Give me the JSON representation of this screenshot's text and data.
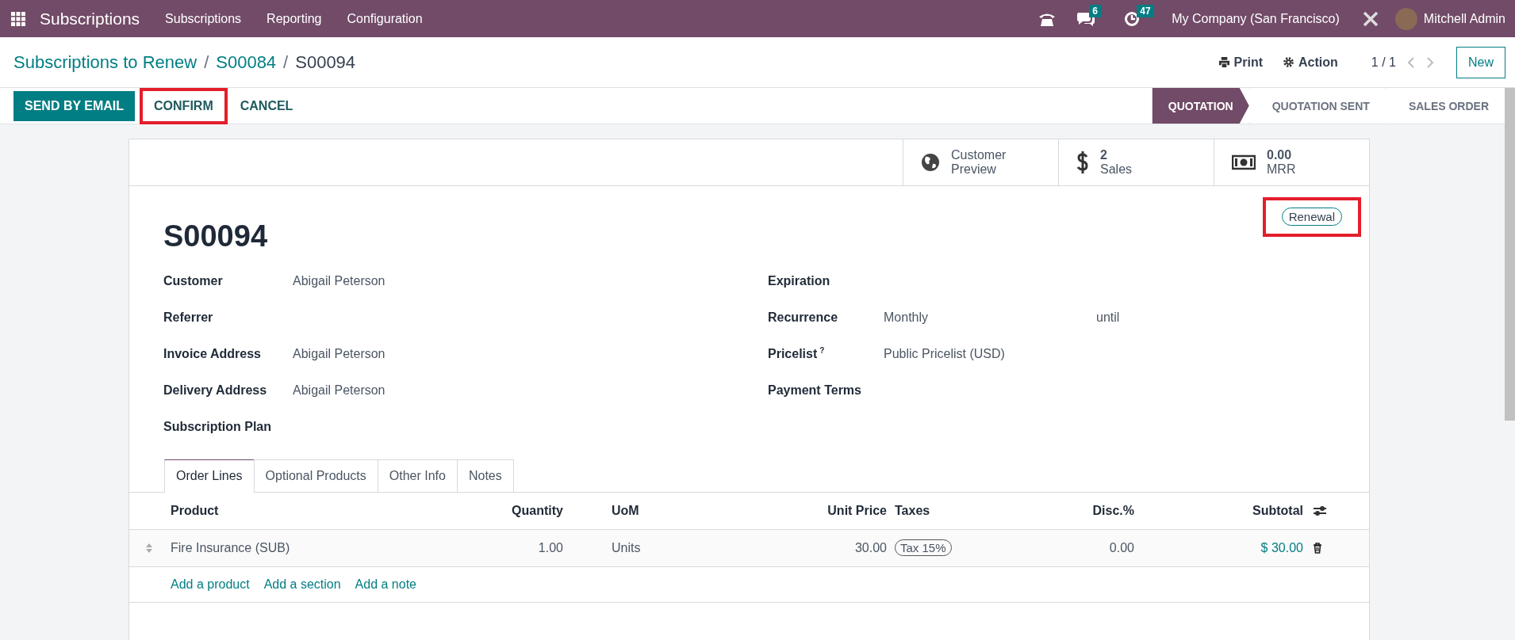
{
  "navbar": {
    "app_name": "Subscriptions",
    "menu": [
      "Subscriptions",
      "Reporting",
      "Configuration"
    ],
    "chat_count": "6",
    "activity_count": "47",
    "company": "My Company (San Francisco)",
    "user": "Mitchell Admin"
  },
  "breadcrumb": [
    "Subscriptions to Renew",
    "/",
    "S00084",
    "/",
    "S00094"
  ],
  "control": {
    "print": "Print",
    "action": "Action",
    "pager": "1 / 1",
    "new": "New"
  },
  "buttons": [
    {
      "label": "SEND BY EMAIL",
      "kind": "primary",
      "highlighted": false
    },
    {
      "label": "CONFIRM",
      "kind": "secondary",
      "highlighted": true
    },
    {
      "label": "CANCEL",
      "kind": "secondary",
      "highlighted": false
    }
  ],
  "statusbar": [
    {
      "label": "QUOTATION",
      "selected": true
    },
    {
      "label": "QUOTATION SENT",
      "selected": false
    },
    {
      "label": "SALES ORDER",
      "selected": false
    }
  ],
  "smart_buttons": [
    {
      "kind": "preview",
      "label": "Customer Preview"
    },
    {
      "kind": "sales",
      "value": "2",
      "label": "Sales"
    },
    {
      "kind": "mrr",
      "value": "0.00",
      "label": "MRR"
    }
  ],
  "record": {
    "name": "S00094",
    "tag": {
      "label": "Renewal",
      "highlighted": true
    }
  },
  "fields_left": [
    {
      "label": "Customer",
      "value": "Abigail Peterson"
    },
    {
      "label": "Referrer"
    },
    {
      "label": "Invoice Address",
      "value": "Abigail Peterson"
    },
    {
      "label": "Delivery Address",
      "value": "Abigail Peterson"
    },
    {
      "label": "Subscription Plan"
    }
  ],
  "fields_right": [
    {
      "label": "Expiration"
    },
    {
      "label": "Recurrence",
      "value": "Monthly",
      "extra": "until"
    },
    {
      "label": "Pricelist",
      "help": "?",
      "value": "Public Pricelist (USD)"
    },
    {
      "label": "Payment Terms"
    }
  ],
  "tabs": [
    {
      "label": "Order Lines",
      "selected": true
    },
    {
      "label": "Optional Products",
      "selected": false
    },
    {
      "label": "Other Info",
      "selected": false
    },
    {
      "label": "Notes",
      "selected": false
    }
  ],
  "table": {
    "columns": [
      "Product",
      "Quantity",
      "UoM",
      "Unit Price",
      "Taxes",
      "Disc.%",
      "Subtotal"
    ],
    "rows": [
      {
        "product": "Fire Insurance (SUB)",
        "quantity": "1.00",
        "uom": "Units",
        "unit_price": "30.00",
        "taxes": [
          "Tax 15%"
        ],
        "discount": "0.00",
        "subtotal": "$ 30.00"
      }
    ],
    "add_links": [
      "Add a product",
      "Add a section",
      "Add a note"
    ]
  }
}
